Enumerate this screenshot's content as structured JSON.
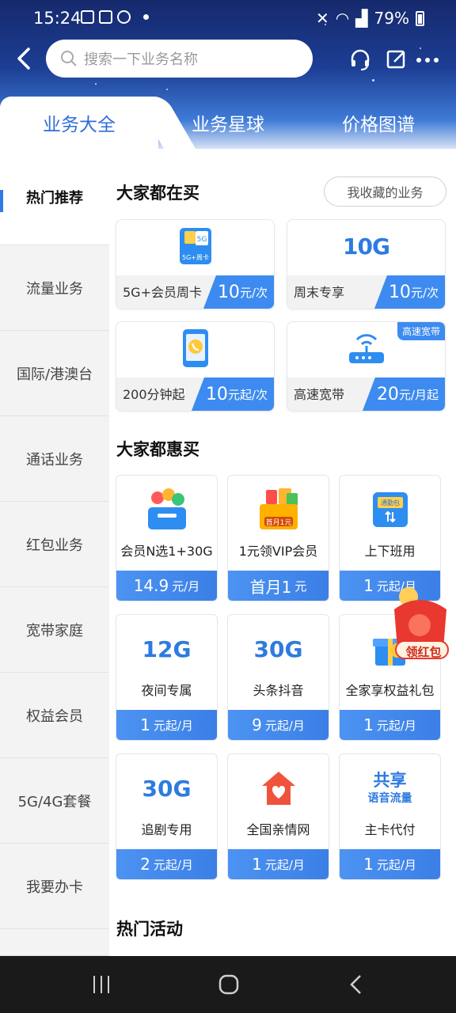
{
  "status": {
    "time": "15:24",
    "battery": "79%"
  },
  "search": {
    "placeholder": "搜索一下业务名称"
  },
  "tabs": [
    {
      "label": "业务大全"
    },
    {
      "label": "业务星球"
    },
    {
      "label": "价格图谱"
    }
  ],
  "sidebar": {
    "items": [
      {
        "label": "热门推荐"
      },
      {
        "label": "流量业务"
      },
      {
        "label": "国际/港澳台"
      },
      {
        "label": "通话业务"
      },
      {
        "label": "红包业务"
      },
      {
        "label": "宽带家庭"
      },
      {
        "label": "权益会员"
      },
      {
        "label": "5G/4G套餐"
      },
      {
        "label": "我要办卡"
      }
    ]
  },
  "section1": {
    "title": "大家都在买",
    "fav_button": "我收藏的业务",
    "cards": [
      {
        "name": "5G+会员周卡",
        "price": "10",
        "unit": "元/次",
        "icon": "5g-card-icon",
        "icon_text": "5G",
        "icon_sub": "5G+周卡"
      },
      {
        "name": "周末专享",
        "price": "10",
        "unit": "元/次",
        "big": "10G"
      },
      {
        "name": "200分钟起",
        "price": "10",
        "unit": "元起/次",
        "icon": "phone-call-icon"
      },
      {
        "name": "高速宽带",
        "price": "20",
        "unit": "元/月起",
        "icon": "router-icon",
        "corner": "高速宽带"
      }
    ]
  },
  "section2": {
    "title": "大家都惠买",
    "cards": [
      {
        "name": "会员N选1+30G",
        "price": "14.9",
        "unit": "元/月",
        "icon": "member-box-icon"
      },
      {
        "name": "1元领VIP会员",
        "price": "首月1",
        "unit": "元",
        "icon": "vip-gift-icon",
        "icon_badge": "首月1元"
      },
      {
        "name": "上下班用",
        "price": "1",
        "unit": "元起/月",
        "icon": "commute-pack-icon",
        "icon_text": "通勤包"
      },
      {
        "name": "夜间专属",
        "price": "1",
        "unit": "元起/月",
        "big": "12G"
      },
      {
        "name": "头条抖音",
        "price": "9",
        "unit": "元起/月",
        "big": "30G"
      },
      {
        "name": "全家享权益礼包",
        "price": "1",
        "unit": "元起/月",
        "icon": "gift-box-icon"
      },
      {
        "name": "追剧专用",
        "price": "2",
        "unit": "元起/月",
        "big": "30G"
      },
      {
        "name": "全国亲情网",
        "price": "1",
        "unit": "元起/月",
        "icon": "family-home-icon"
      },
      {
        "name": "主卡代付",
        "price": "1",
        "unit": "元起/月",
        "big": "共享",
        "big_sub": "语音流量"
      }
    ]
  },
  "section3": {
    "title": "热门活动"
  },
  "floating": {
    "label": "领红包"
  },
  "colors": {
    "accent": "#3d8bf0",
    "header_dark": "#16296c"
  }
}
